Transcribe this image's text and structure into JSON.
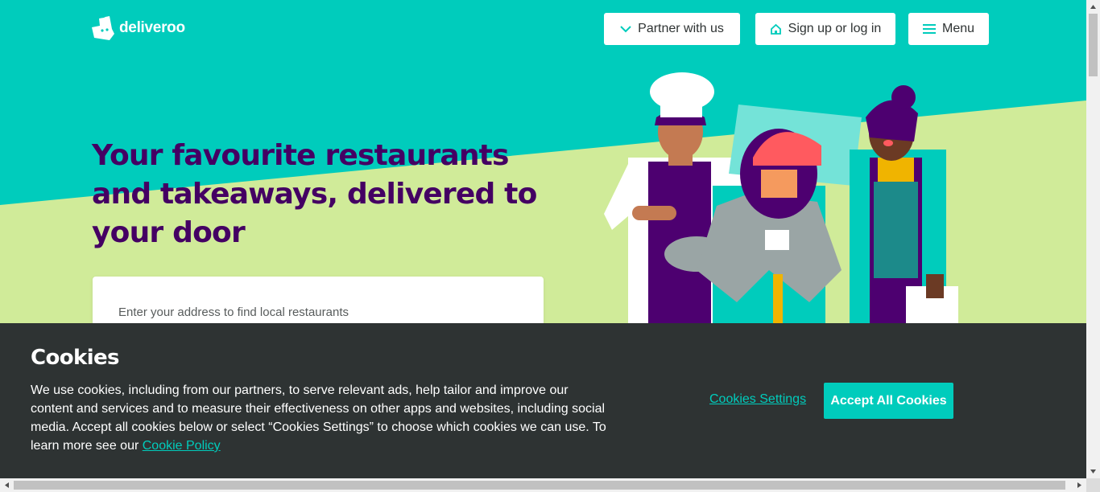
{
  "header": {
    "logo_text": "deliveroo",
    "partner_label": "Partner with us",
    "signup_label": "Sign up or log in",
    "menu_label": "Menu"
  },
  "hero": {
    "headline": "Your favourite restaurants and takeaways, delivered to your door",
    "address_placeholder": "Enter your address to find local restaurants"
  },
  "cookies": {
    "title": "Cookies",
    "body": "We use cookies, including from our partners, to serve relevant ads, help tailor and improve our content and services and to measure their effectiveness on other apps and websites, including social media. Accept all cookies below or select “Cookies Settings” to choose which cookies we can use. To learn more see our",
    "policy_link": "Cookie Policy",
    "settings_label": "Cookies Settings",
    "accept_label": "Accept All Cookies"
  },
  "colors": {
    "brand_teal": "#00ccbc",
    "hero_green": "#d0eb99",
    "headline_purple": "#440063",
    "banner_bg": "#2e3333"
  },
  "icons": [
    "deliveroo-kangaroo-icon",
    "chevron-down-icon",
    "home-icon",
    "hamburger-menu-icon"
  ]
}
